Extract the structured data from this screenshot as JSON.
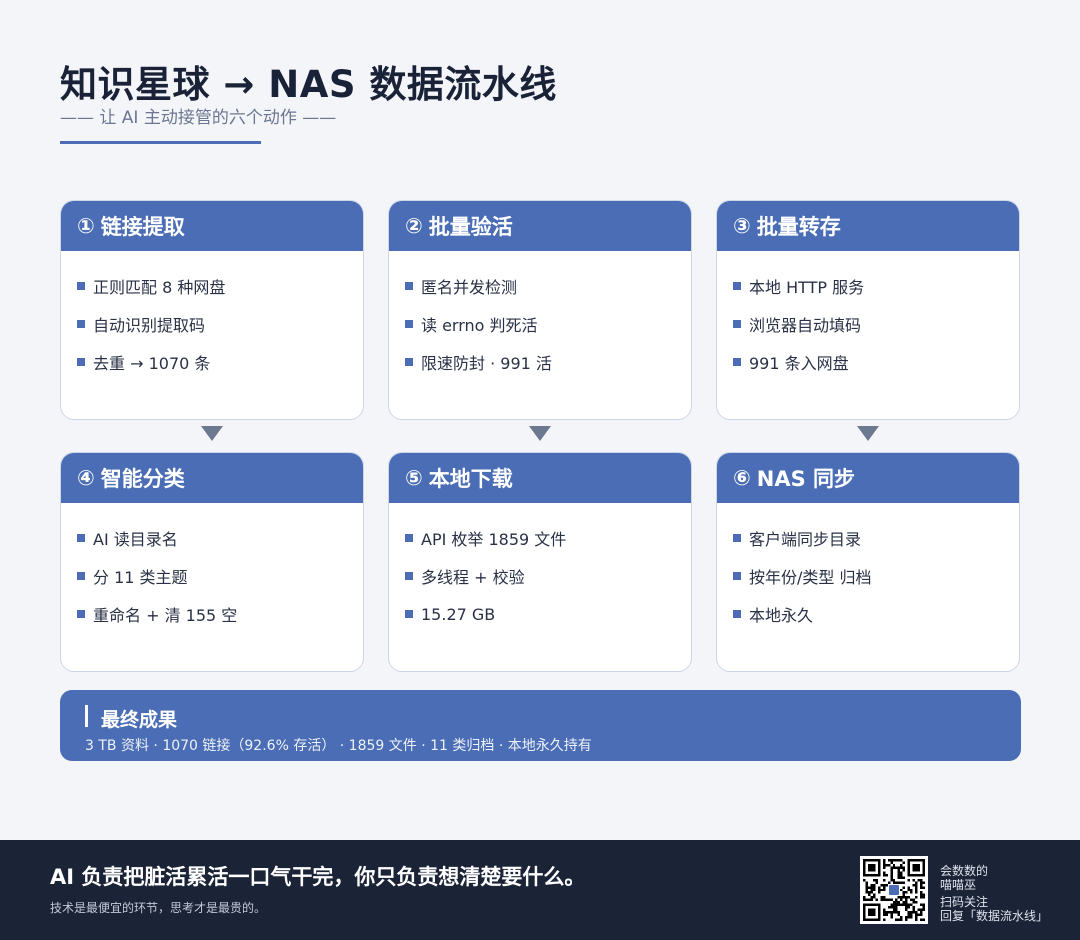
{
  "header": {
    "title": "知识星球 → NAS 数据流水线",
    "subtitle": "—— 让 AI 主动接管的六个动作 ——"
  },
  "steps": [
    {
      "num": "①",
      "title": "链接提取",
      "items": [
        "正则匹配 8 种网盘",
        "自动识别提取码",
        "去重 → 1070 条"
      ]
    },
    {
      "num": "②",
      "title": "批量验活",
      "items": [
        "匿名并发检测",
        "读 errno 判死活",
        "限速防封 · 991 活"
      ]
    },
    {
      "num": "③",
      "title": "批量转存",
      "items": [
        "本地 HTTP 服务",
        "浏览器自动填码",
        "991 条入网盘"
      ]
    },
    {
      "num": "④",
      "title": "智能分类",
      "items": [
        "AI 读目录名",
        "分 11 类主题",
        "重命名 + 清 155 空"
      ]
    },
    {
      "num": "⑤",
      "title": "本地下载",
      "items": [
        "API 枚举 1859 文件",
        "多线程 + 校验",
        "15.27 GB"
      ]
    },
    {
      "num": "⑥",
      "title": "NAS 同步",
      "items": [
        "客户端同步目录",
        "按年份/类型 归档",
        "本地永久"
      ]
    }
  ],
  "result": {
    "title": "最终成果",
    "text": "3 TB 资料 · 1070 链接（92.6% 存活） · 1859 文件 · 11 类归档 · 本地永久持有"
  },
  "footer": {
    "main": "AI 负责把脏活累活一口气干完，你只负责想清楚要什么。",
    "sub": "技术是最便宜的环节，思考才是最贵的。",
    "qr_name_1": "会数数的",
    "qr_name_2": "喵喵巫",
    "qr_action_1": "扫码关注",
    "qr_action_2": "回复「数据流水线」"
  },
  "colors": {
    "accent": "#4a6db5",
    "footer_bg": "#1b2337",
    "page_bg": "#f3f5f9"
  }
}
